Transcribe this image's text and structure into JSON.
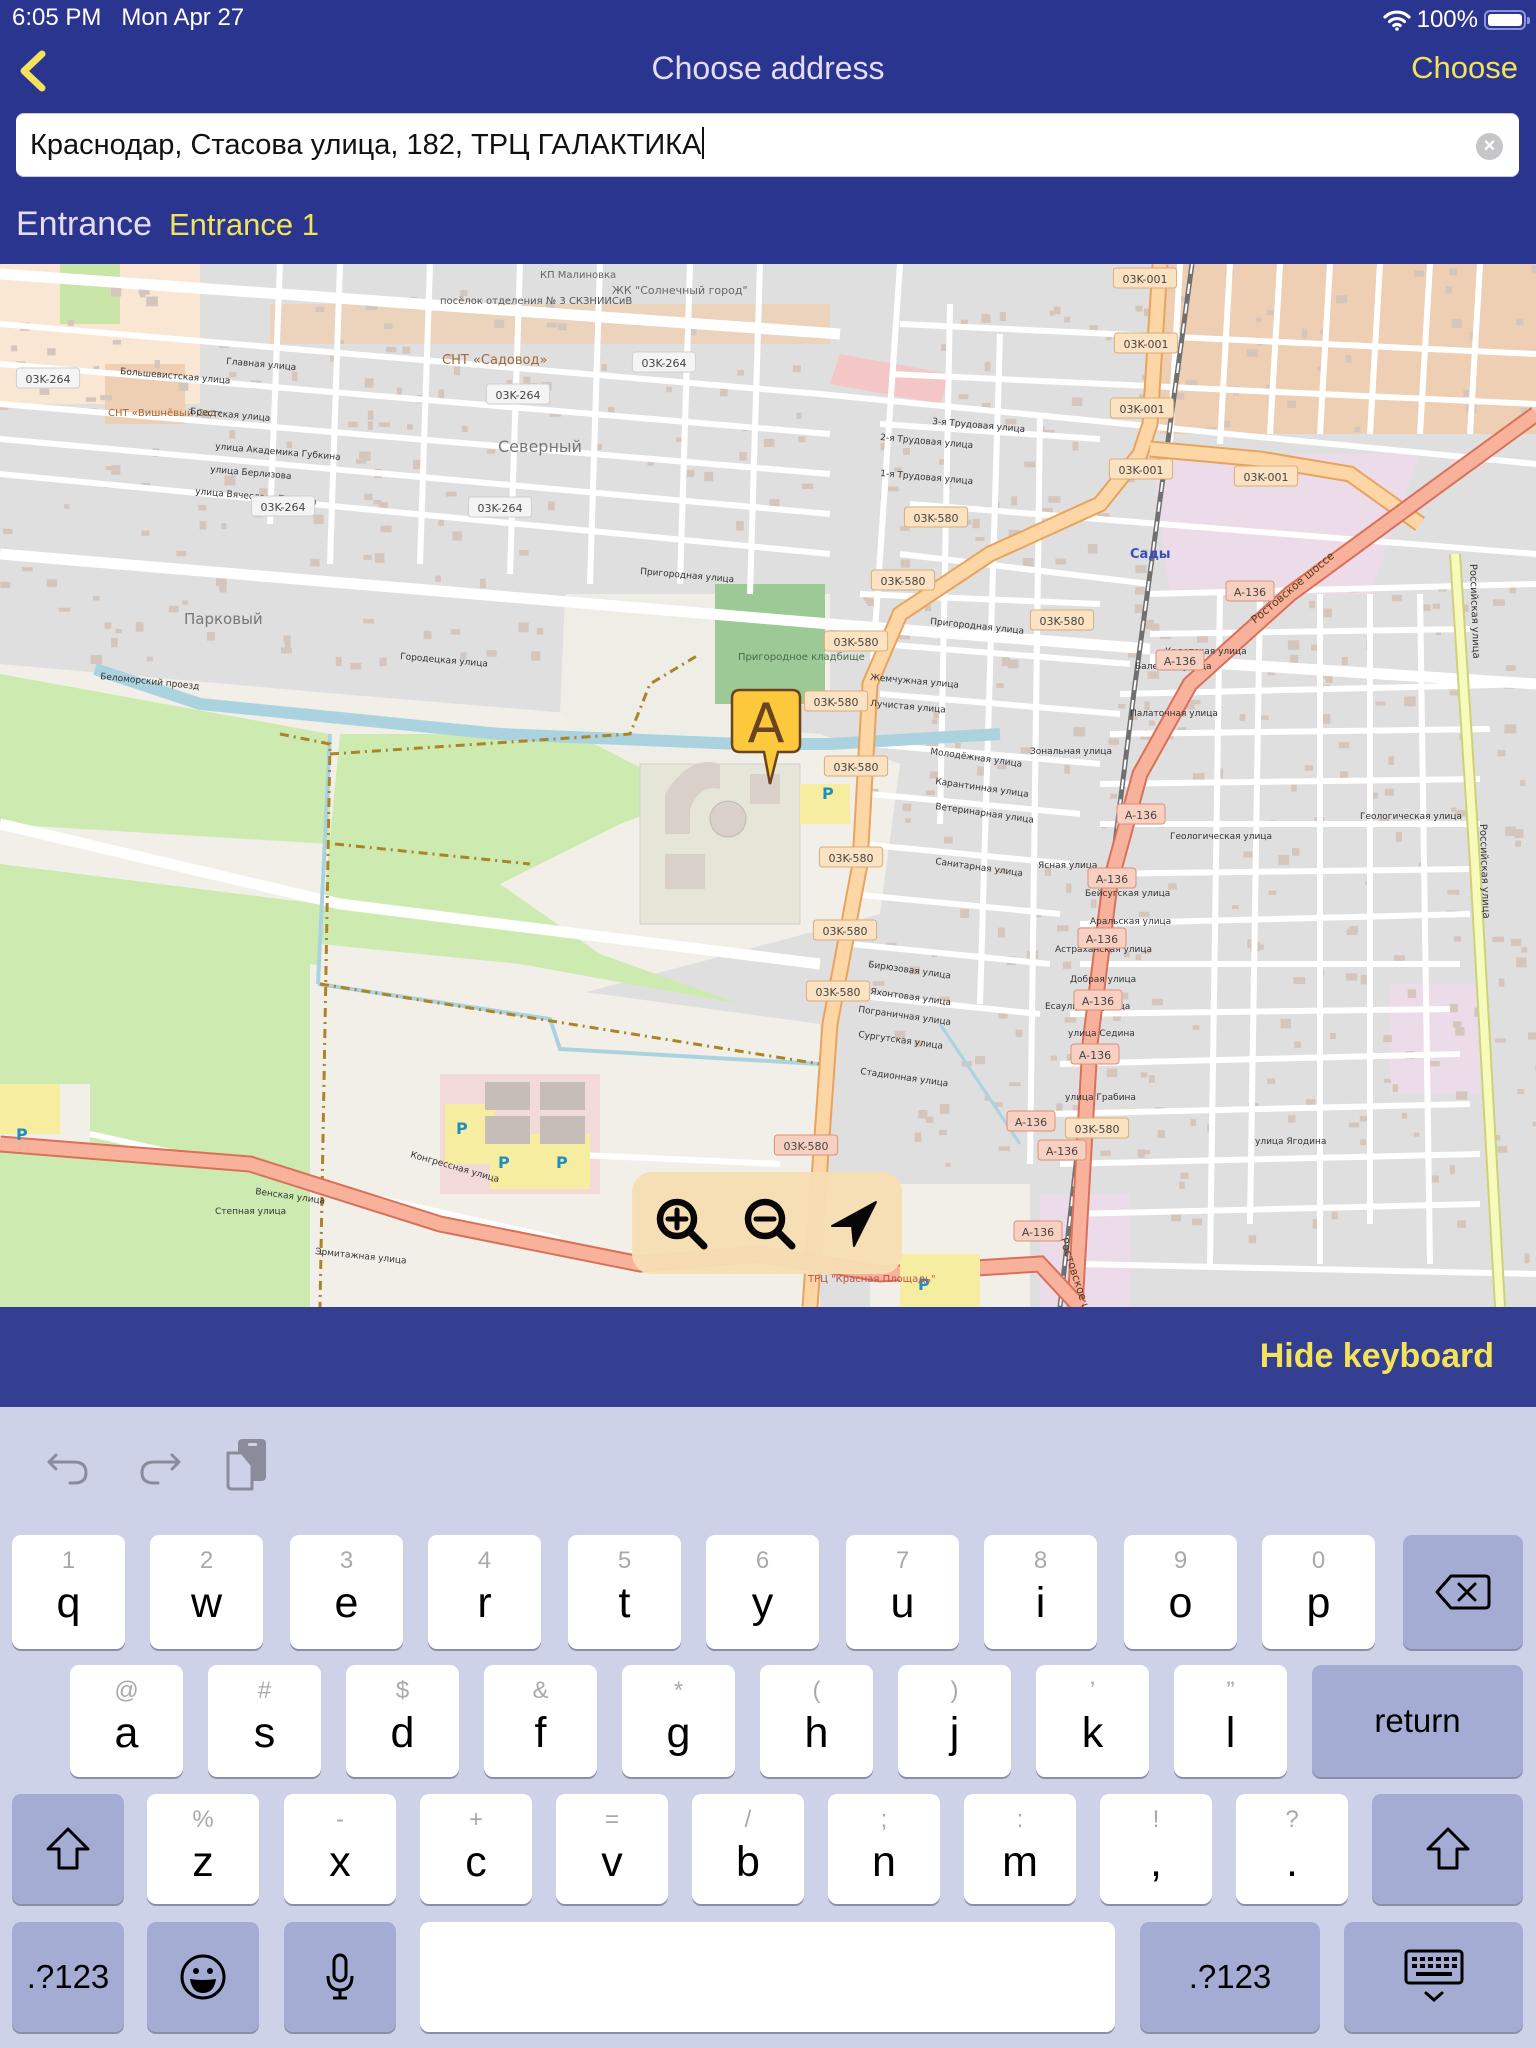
{
  "status_bar": {
    "time": "6:05 PM",
    "date": "Mon Apr 27",
    "wifi_icon": "wifi-icon",
    "battery_percent": "100%",
    "battery_level": 1.0
  },
  "nav": {
    "back_icon": "chevron-left-icon",
    "title": "Choose address",
    "choose_label": "Choose"
  },
  "address": {
    "value": "Краснодар, Стасова улица, 182, ТРЦ ГАЛАКТИКА",
    "clear_icon": "clear-circle-icon"
  },
  "entrance": {
    "label": "Entrance",
    "value": "Entrance 1"
  },
  "map": {
    "marker_label": "A",
    "colors": {
      "residential": "#e0dfdf",
      "farmland": "#cdebb0",
      "garden": "#eecfb3",
      "primary_road": "#fcd6a4",
      "trunk_road": "#f8b29c",
      "secondary_road": "#f6fabb",
      "water": "#aad3df",
      "marker": "#fcc83c"
    },
    "place_labels": [
      "Северный",
      "Парковый",
      "Сады",
      "СНТ «Садовод»",
      "СНТ «Вишнёвый Сад»",
      "ЖК \"Солнечный город\"",
      "посёлок отделения № 3 СКЗНИИСиВ",
      "КП Малиновка",
      "Пригородное кладбище",
      "ТРЦ \"Красная Площадь\""
    ],
    "road_shields": [
      "03K-264",
      "03K-264",
      "03K-264",
      "03K-264",
      "03K-264",
      "03K-001",
      "03K-001",
      "03K-001",
      "03K-001",
      "03K-001",
      "03K-580",
      "03K-580",
      "03K-580",
      "03K-580",
      "03K-580",
      "03K-580",
      "03K-580",
      "03K-580",
      "03K-580",
      "03K-580",
      "03K-580",
      "A-136",
      "A-136",
      "A-136",
      "A-136",
      "A-136",
      "A-136",
      "A-136",
      "A-136",
      "A-136",
      "A-136"
    ],
    "street_labels": [
      "Пригородная улица",
      "Большевистская улица",
      "Главная улица",
      "Брестская улица",
      "улица Академика Губкина",
      "улица Берлизова",
      "улица Вячеслава Ткачёва",
      "3-я Трудовая улица",
      "2-я Трудовая улица",
      "1-я Трудовая улица",
      "Беломорский проезд",
      "Городецкая улица",
      "Ростовское шоссе",
      "Российская улица",
      "Конгрессная улица",
      "Венская улица",
      "Степная улица",
      "Эрмитажная улица",
      "Геологическая улица",
      "Зональная улица",
      "Ясная улица",
      "Бейсугская улица",
      "Аральская улица",
      "Астраханская улица",
      "Добрая улица",
      "Есаульская улица",
      "улица Седина",
      "улица Ягодина",
      "улица Грабина",
      "Кадетская улица",
      "Палаточная улица",
      "Балетная улица",
      "Жемчужная улица",
      "Лучистая улица",
      "Молодёжная улица",
      "Карантинная улица",
      "Ветеринарная улица",
      "Санитарная улица",
      "Бирюзовая улица",
      "Яхонтовая улица",
      "Пограничная улица",
      "Сургутская улица",
      "Стадионная улица"
    ],
    "parking_label": "P",
    "controls": {
      "zoom_in_icon": "zoom-in-icon",
      "zoom_out_icon": "zoom-out-icon",
      "locate_icon": "location-arrow-icon"
    }
  },
  "keyboard_bar": {
    "hide_label": "Hide keyboard"
  },
  "keyboard": {
    "toolbar": [
      "undo-icon",
      "redo-icon",
      "paste-icon"
    ],
    "row1": [
      {
        "main": "q",
        "sub": "1"
      },
      {
        "main": "w",
        "sub": "2"
      },
      {
        "main": "e",
        "sub": "3"
      },
      {
        "main": "r",
        "sub": "4"
      },
      {
        "main": "t",
        "sub": "5"
      },
      {
        "main": "y",
        "sub": "6"
      },
      {
        "main": "u",
        "sub": "7"
      },
      {
        "main": "i",
        "sub": "8"
      },
      {
        "main": "o",
        "sub": "9"
      },
      {
        "main": "p",
        "sub": "0"
      }
    ],
    "row2": [
      {
        "main": "a",
        "sub": "@"
      },
      {
        "main": "s",
        "sub": "#"
      },
      {
        "main": "d",
        "sub": "$"
      },
      {
        "main": "f",
        "sub": "&"
      },
      {
        "main": "g",
        "sub": "*"
      },
      {
        "main": "h",
        "sub": "("
      },
      {
        "main": "j",
        "sub": ")"
      },
      {
        "main": "k",
        "sub": "’"
      },
      {
        "main": "l",
        "sub": "”"
      }
    ],
    "row3": [
      {
        "main": "z",
        "sub": "%"
      },
      {
        "main": "x",
        "sub": "-"
      },
      {
        "main": "c",
        "sub": "+"
      },
      {
        "main": "v",
        "sub": "="
      },
      {
        "main": "b",
        "sub": "/"
      },
      {
        "main": "n",
        "sub": ";"
      },
      {
        "main": "m",
        "sub": ":"
      },
      {
        "main": ",",
        "sub": "!"
      },
      {
        "main": ".",
        "sub": "?"
      }
    ],
    "return_label": "return",
    "numbers_label": ".?123",
    "delete_icon": "backspace-icon",
    "shift_icon": "shift-icon",
    "emoji_icon": "emoji-icon",
    "mic_icon": "microphone-icon",
    "dismiss_icon": "keyboard-dismiss-icon"
  }
}
